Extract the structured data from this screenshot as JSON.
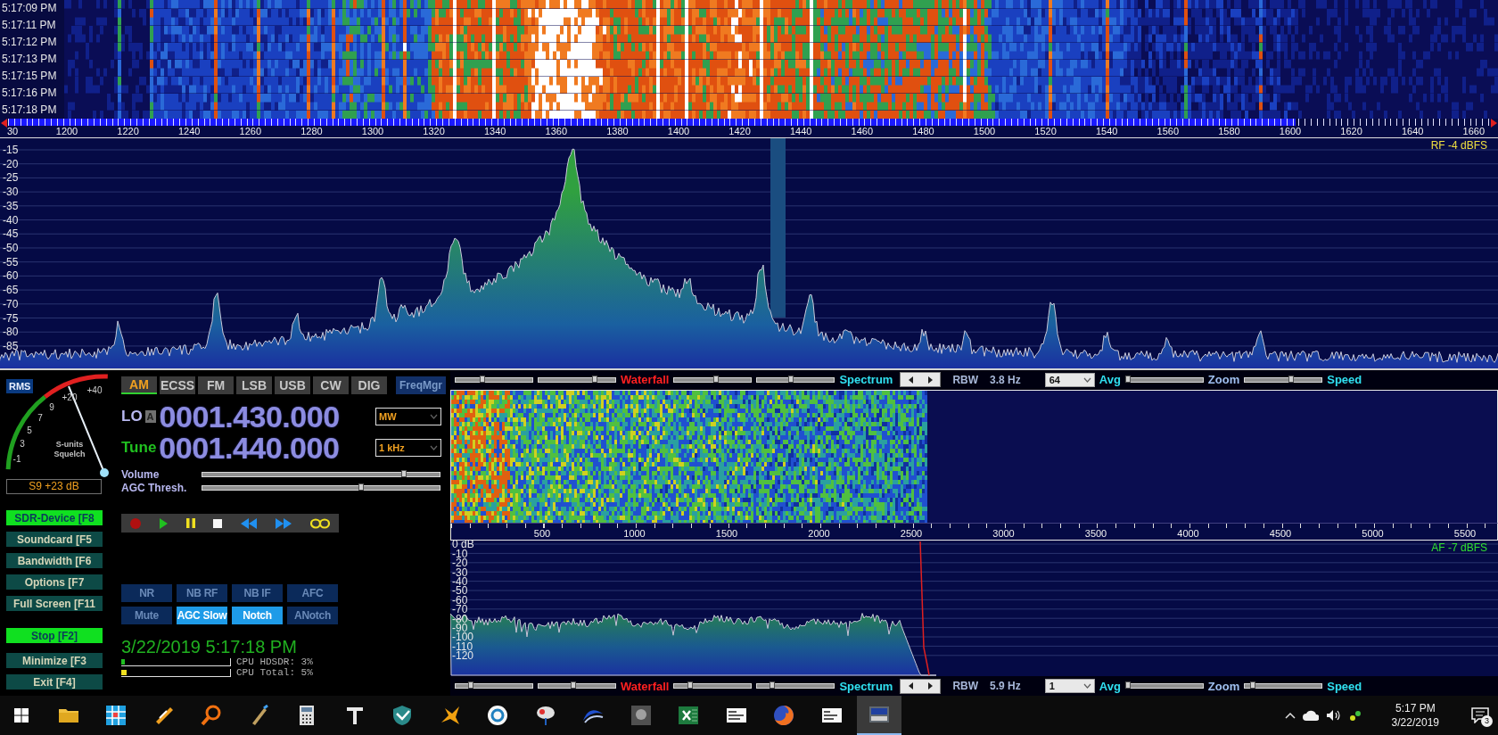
{
  "waterfall": {
    "timestamps": [
      "5:17:09 PM",
      "5:17:11 PM",
      "5:17:12 PM",
      "5:17:13 PM",
      "5:17:15 PM",
      "5:17:16 PM",
      "5:17:18 PM"
    ]
  },
  "frequency_axis": {
    "labels": [
      "30",
      "1200",
      "1220",
      "1240",
      "1260",
      "1280",
      "1300",
      "1320",
      "1340",
      "1360",
      "1380",
      "1400",
      "1420",
      "1440",
      "1460",
      "1480",
      "1500",
      "1520",
      "1540",
      "1560",
      "1580",
      "1600",
      "1620",
      "1640",
      "1660"
    ]
  },
  "rf_spectrum": {
    "y_labels": [
      "-15",
      "-20",
      "-25",
      "-30",
      "-35",
      "-40",
      "-45",
      "-50",
      "-55",
      "-60",
      "-65",
      "-70",
      "-75",
      "-80",
      "-85"
    ],
    "reading": "RF -4 dBFS"
  },
  "s_meter": {
    "mode_button": "RMS",
    "scale_labels": [
      "-1",
      "3",
      "5",
      "7",
      "9",
      "+20",
      "+40"
    ],
    "caption_lines": [
      "S-units",
      "Squelch"
    ],
    "reading": "S9 +23 dB"
  },
  "function_buttons": [
    {
      "label": "SDR-Device [F8",
      "active": true
    },
    {
      "label": "Soundcard [F5",
      "active": false
    },
    {
      "label": "Bandwidth [F6",
      "active": false
    },
    {
      "label": "Options [F7",
      "active": false
    },
    {
      "label": "Full Screen [F11",
      "active": false
    },
    {
      "label": "Stop [F2]",
      "active": true
    },
    {
      "label": "Minimize [F3",
      "active": false
    },
    {
      "label": "Exit [F4]",
      "active": false
    }
  ],
  "modes": [
    {
      "label": "AM",
      "selected": true
    },
    {
      "label": "ECSS",
      "selected": false
    },
    {
      "label": "FM",
      "selected": false
    },
    {
      "label": "LSB",
      "selected": false
    },
    {
      "label": "USB",
      "selected": false
    },
    {
      "label": "CW",
      "selected": false
    },
    {
      "label": "DIG",
      "selected": false
    }
  ],
  "freq_manager": "FreqMgr",
  "lo": {
    "label": "LO",
    "vfo": "A",
    "frequency": "0001.430.000",
    "band": "MW"
  },
  "tune": {
    "label": "Tune",
    "frequency": "0001.440.000",
    "step": "1 kHz"
  },
  "sliders": [
    {
      "label": "Volume",
      "level": 0.85
    },
    {
      "label": "AGC Thresh.",
      "level": 0.67
    }
  ],
  "transport": [
    {
      "kind": "record"
    },
    {
      "kind": "play"
    },
    {
      "kind": "pause"
    },
    {
      "kind": "stop"
    },
    {
      "kind": "rewind"
    },
    {
      "kind": "forward"
    },
    {
      "kind": "loop"
    }
  ],
  "dsp_buttons": [
    {
      "label": "NR",
      "on": false
    },
    {
      "label": "NB RF",
      "on": false
    },
    {
      "label": "NB IF",
      "on": false
    },
    {
      "label": "AFC",
      "on": false
    },
    {
      "label": "Mute",
      "on": false
    },
    {
      "label": "AGC Slow",
      "on": true
    },
    {
      "label": "Notch",
      "on": true
    },
    {
      "label": "ANotch",
      "on": false
    }
  ],
  "datetime": "3/22/2019 5:17:18 PM",
  "cpu": [
    {
      "label": "CPU HDSDR: 3%",
      "level": 0.03
    },
    {
      "label": "CPU Total: 5%",
      "level": 0.05
    }
  ],
  "audio_top_bar": {
    "items": [
      {
        "kind": "slider",
        "level": 0.35
      },
      {
        "kind": "slider",
        "level": 0.73
      },
      {
        "kind": "label",
        "text": "Waterfall",
        "color": "#ff2020"
      },
      {
        "kind": "slider",
        "level": 0.54
      },
      {
        "kind": "slider",
        "level": 0.44
      },
      {
        "kind": "label",
        "text": "Spectrum",
        "color": "#30e0f0"
      },
      {
        "kind": "spinner"
      },
      {
        "kind": "text",
        "text": "RBW"
      },
      {
        "kind": "text",
        "text": "3.8 Hz"
      },
      {
        "kind": "dropdown",
        "text": "64"
      },
      {
        "kind": "label",
        "text": "Avg",
        "color": "#30e0f0"
      },
      {
        "kind": "slider",
        "level": 0.02
      },
      {
        "kind": "label",
        "text": "Zoom",
        "color": "#a0c0f0"
      },
      {
        "kind": "slider",
        "level": 0.6
      },
      {
        "kind": "label",
        "text": "Speed",
        "color": "#30e0f0"
      }
    ]
  },
  "audio_axis": {
    "labels": [
      "500",
      "1000",
      "1500",
      "2000",
      "2500",
      "3000",
      "3500",
      "4000",
      "4500",
      "5000",
      "5500"
    ]
  },
  "af_spectrum": {
    "y_labels": [
      "0 dB",
      "-10",
      "-20",
      "-30",
      "-40",
      "-50",
      "-60",
      "-70",
      "-80",
      "-90",
      "-100",
      "-110",
      "-120"
    ],
    "reading": "AF -7 dBFS"
  },
  "audio_bottom_bar": {
    "items": [
      {
        "kind": "slider",
        "level": 0.2
      },
      {
        "kind": "slider",
        "level": 0.45
      },
      {
        "kind": "label",
        "text": "Waterfall",
        "color": "#ff2020"
      },
      {
        "kind": "slider",
        "level": 0.2
      },
      {
        "kind": "slider",
        "level": 0.19
      },
      {
        "kind": "label",
        "text": "Spectrum",
        "color": "#30e0f0"
      },
      {
        "kind": "spinner"
      },
      {
        "kind": "text",
        "text": "RBW"
      },
      {
        "kind": "text",
        "text": "5.9 Hz"
      },
      {
        "kind": "dropdown",
        "text": "1"
      },
      {
        "kind": "label",
        "text": "Avg",
        "color": "#30e0f0"
      },
      {
        "kind": "slider",
        "level": 0.02
      },
      {
        "kind": "label",
        "text": "Zoom",
        "color": "#a0c0f0"
      },
      {
        "kind": "slider",
        "level": 0.1
      },
      {
        "kind": "label",
        "text": "Speed",
        "color": "#30e0f0"
      }
    ]
  },
  "taskbar": {
    "apps": [
      {
        "selected": false
      },
      {
        "selected": false
      },
      {
        "selected": false
      },
      {
        "selected": false
      },
      {
        "selected": false
      },
      {
        "selected": false
      },
      {
        "selected": false
      },
      {
        "selected": false
      },
      {
        "selected": false
      },
      {
        "selected": false
      },
      {
        "selected": false
      },
      {
        "selected": false
      },
      {
        "selected": false
      },
      {
        "selected": false
      },
      {
        "selected": false
      },
      {
        "selected": false
      },
      {
        "selected": false
      },
      {
        "selected": true
      }
    ],
    "time": "5:17 PM",
    "date": "3/22/2019",
    "notification_count": "3"
  }
}
